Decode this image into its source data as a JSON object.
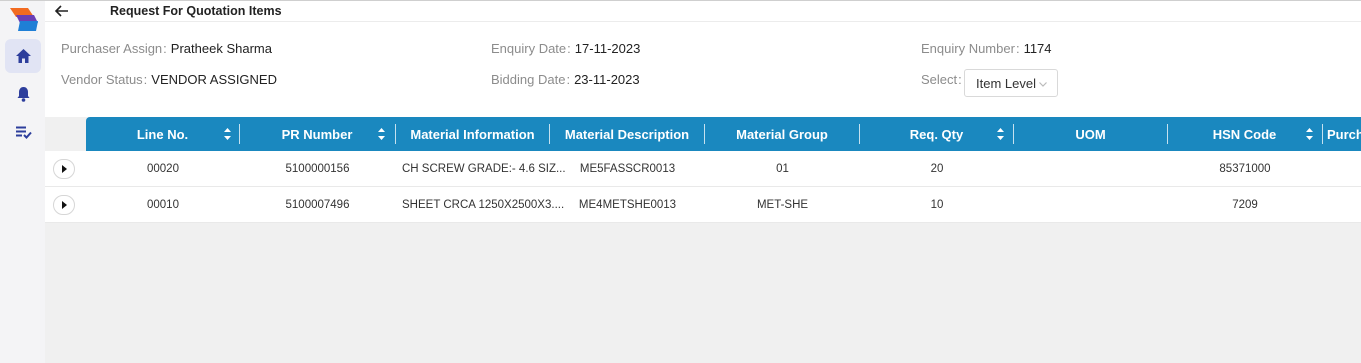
{
  "header": {
    "title": "Request For Quotation Items"
  },
  "info": {
    "purchaser_label": "Purchaser Assign",
    "purchaser_value": "Pratheek Sharma",
    "vendor_status_label": "Vendor Status",
    "vendor_status_value": "VENDOR ASSIGNED",
    "enquiry_date_label": "Enquiry Date",
    "enquiry_date_value": "17-11-2023",
    "bidding_date_label": "Bidding Date",
    "bidding_date_value": "23-11-2023",
    "enquiry_number_label": "Enquiry Number",
    "enquiry_number_value": "1174",
    "select_label": "Select",
    "select_value": "Item Level",
    "separator": ":"
  },
  "sidebar": {
    "items": [
      {
        "icon": "home-icon",
        "active": true
      },
      {
        "icon": "bell-icon",
        "active": false
      },
      {
        "icon": "checklist-icon",
        "active": false
      }
    ]
  },
  "table": {
    "columns": [
      "Line No.",
      "PR Number",
      "Material Information",
      "Material Description",
      "Material Group",
      "Req. Qty",
      "UOM",
      "HSN Code",
      "Purch"
    ],
    "rows": [
      {
        "line_no": "00020",
        "pr_number": "5100000156",
        "material_info": "CH SCREW GRADE:- 4.6 SIZ...",
        "material_desc": "ME5FASSCR0013",
        "material_group": "01",
        "req_qty": "20",
        "uom": "",
        "hsn_code": "85371000"
      },
      {
        "line_no": "00010",
        "pr_number": "5100007496",
        "material_info": "SHEET CRCA 1250X2500X3....",
        "material_desc": "ME4METSHE0013",
        "material_group": "MET-SHE",
        "req_qty": "10",
        "uom": "",
        "hsn_code": "7209"
      }
    ]
  },
  "colors": {
    "header_bg": "#1a88bf",
    "sidebar_bg": "#f4f4f6",
    "active_nav_bg": "#e1e4f4",
    "icon_blue": "#2d3e9c"
  }
}
